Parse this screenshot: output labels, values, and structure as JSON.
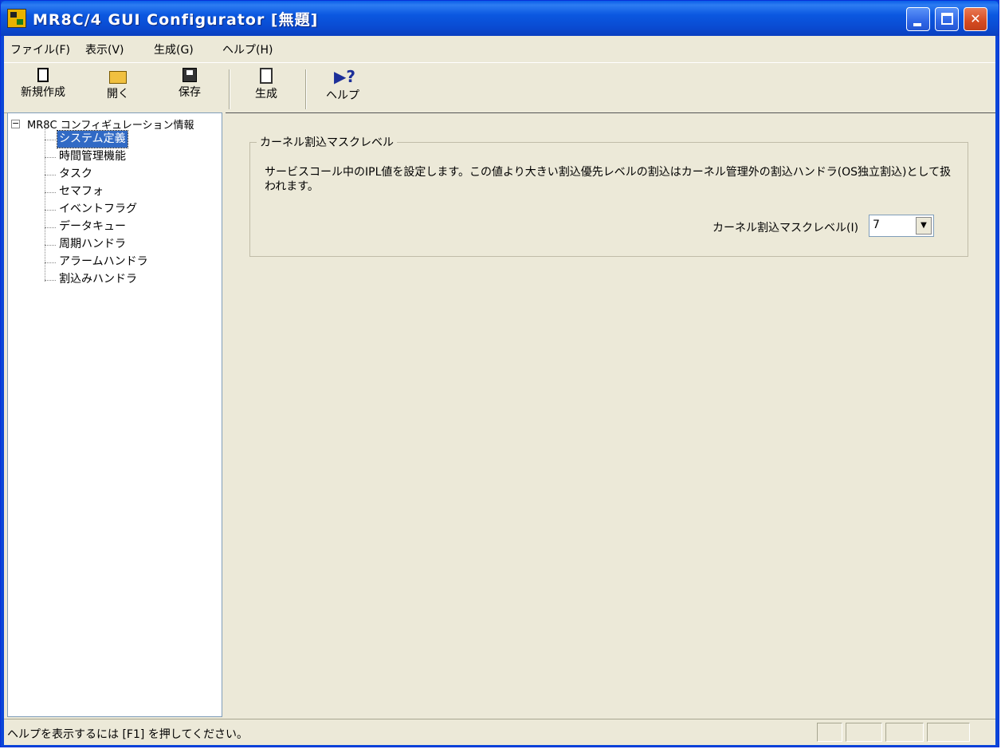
{
  "window": {
    "title": "MR8C/4 GUI Configurator [無題]",
    "minimize_glyph": "",
    "maximize_glyph": "",
    "close_glyph": "✕"
  },
  "menu": {
    "items": [
      {
        "label": "ファイル(F)"
      },
      {
        "label": "表示(V)"
      },
      {
        "label": "生成(G)"
      },
      {
        "label": "ヘルプ(H)"
      }
    ]
  },
  "toolbar": {
    "new_label": "新規作成",
    "open_label": "開く",
    "save_label": "保存",
    "generate_label": "生成",
    "help_label": "ヘルプ",
    "help_glyph": "▶?"
  },
  "tree": {
    "expander_glyph": "−",
    "root_label": "MR8C コンフィギュレーション情報",
    "items": [
      {
        "label": "システム定義",
        "selected": true
      },
      {
        "label": "時間管理機能"
      },
      {
        "label": "タスク"
      },
      {
        "label": "セマフォ"
      },
      {
        "label": "イベントフラグ"
      },
      {
        "label": "データキュー"
      },
      {
        "label": "周期ハンドラ"
      },
      {
        "label": "アラームハンドラ"
      },
      {
        "label": "割込みハンドラ"
      }
    ]
  },
  "panel": {
    "group_title": "カーネル割込マスクレベル",
    "description": "サービスコール中のIPL値を設定します。この値より大きい割込優先レベルの割込はカーネル管理外の割込ハンドラ(OS独立割込)として扱われます。",
    "mask_level_label": "カーネル割込マスクレベル(I)",
    "mask_level_value": "7",
    "dropdown_glyph": "▼"
  },
  "status": {
    "text": "ヘルプを表示するには [F1] を押してください。"
  }
}
